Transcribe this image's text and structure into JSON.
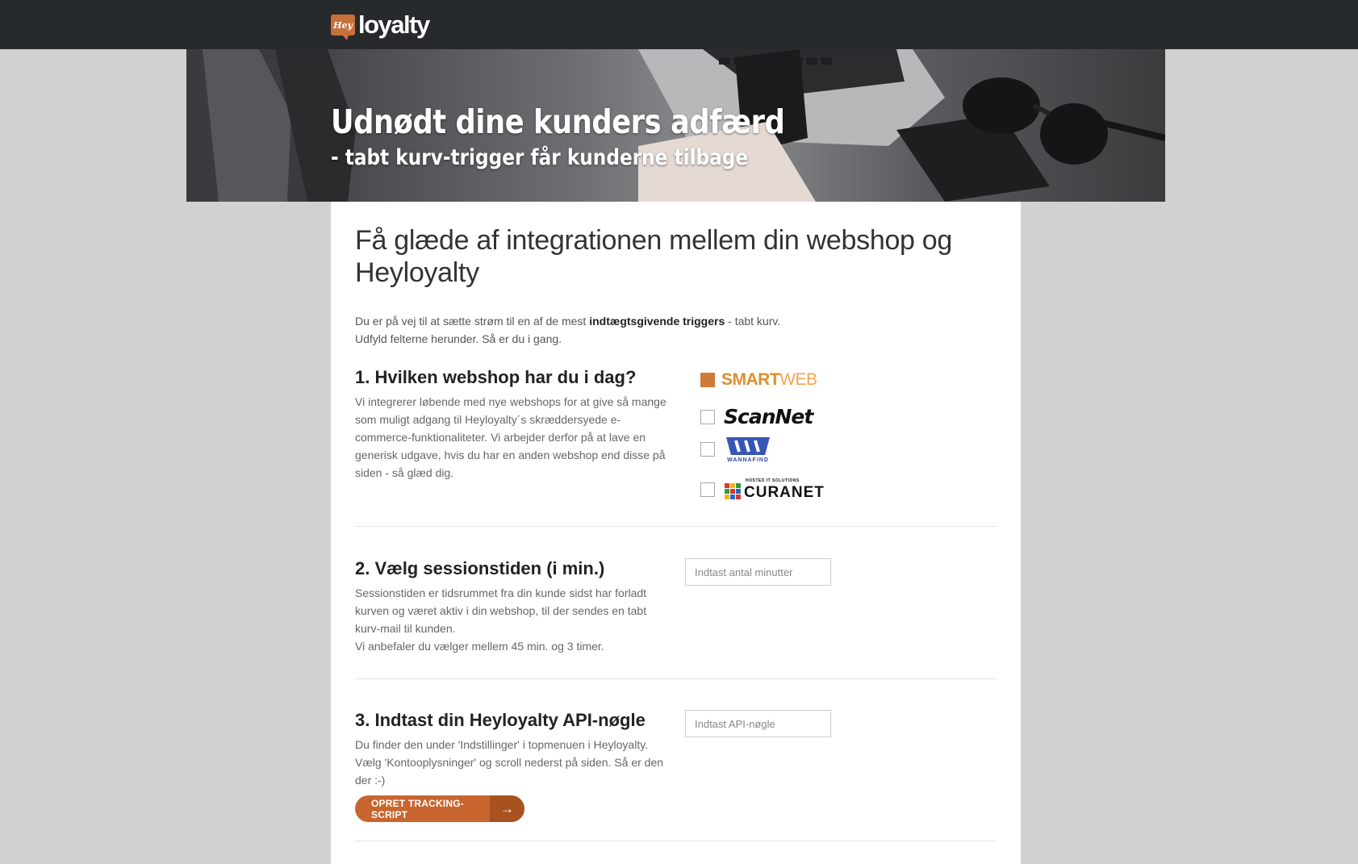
{
  "header": {
    "logo_badge": "Hey",
    "logo_text": "loyalty"
  },
  "hero": {
    "title": "Udnødt dine kunders adfærd",
    "subtitle": "- tabt kurv-trigger får kunderne tilbage"
  },
  "main": {
    "heading": "Få glæde af integrationen mellem din webshop og Heyloyalty",
    "intro_part1": "Du er på vej til at sætte strøm til en af de mest ",
    "intro_bold": "indtægtsgivende triggers",
    "intro_part2": " - tabt kurv.",
    "intro_line2": "Udfyld felterne herunder. Så er du i gang."
  },
  "section1": {
    "title": "1. Hvilken webshop har du i dag?",
    "description": "Vi integrerer løbende med nye webshops for at give så mange som muligt adgang til Heyloyalty´s skræddersyede e-commerce-funktionaliteter. Vi arbejder derfor på at lave en generisk udgave, hvis du har en anden webshop end disse på siden - så glæd dig.",
    "options": [
      {
        "name": "SMARTWEB",
        "part1": "SMART",
        "part2": "WEB",
        "checked": true
      },
      {
        "name": "ScanNet",
        "checked": false
      },
      {
        "name": "WANNAFIND",
        "checked": false
      },
      {
        "name": "CURANET",
        "tagline": "HOSTED IT SOLUTIONS",
        "checked": false
      }
    ]
  },
  "section2": {
    "title": "2. Vælg sessionstiden (i min.)",
    "description": "Sessionstiden er tidsrummet fra din kunde sidst har forladt kurven og været aktiv i din webshop, til der sendes en tabt kurv-mail til kunden.",
    "description2": "Vi anbefaler du vælger mellem 45 min. og 3 timer.",
    "input_placeholder": "Indtast antal minutter",
    "input_value": ""
  },
  "section3": {
    "title": "3. Indtast din Heyloyalty API-nøgle",
    "description": "Du finder den under 'Indstillinger' i topmenuen i Heyloyalty. Vælg 'Kontooplysninger' og scroll nederst på siden. Så er den der :-)",
    "input_placeholder": "Indtast API-nøgle",
    "input_value": "",
    "button_label": "OPRET TRACKING-SCRIPT",
    "button_arrow": "→"
  },
  "colors": {
    "topbar": "#272a2d",
    "accent": "#c8652e",
    "background": "#d1d1d1"
  }
}
